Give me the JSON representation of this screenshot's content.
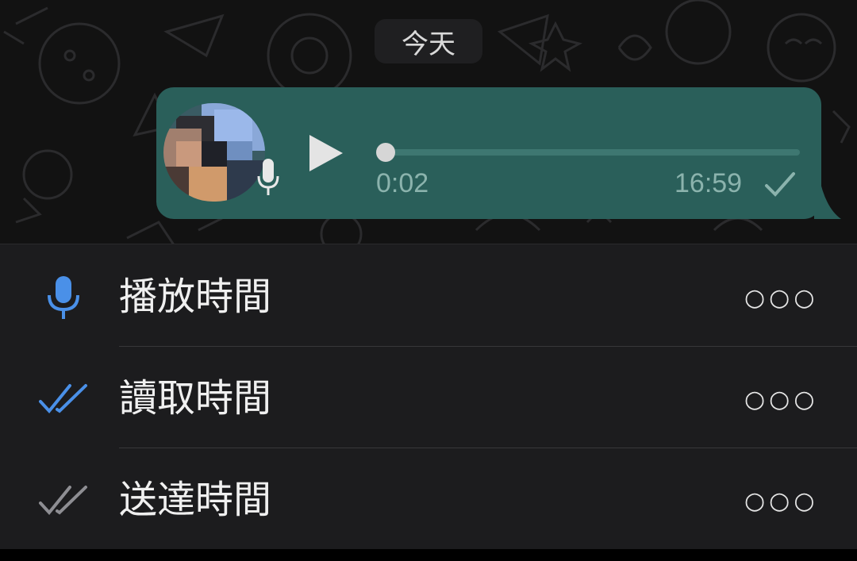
{
  "chat": {
    "date_label": "今天",
    "voice_message": {
      "duration": "0:02",
      "time": "16:59",
      "progress": 0
    }
  },
  "info": {
    "rows": [
      {
        "label": "播放時間",
        "value": "○○○",
        "icon": "microphone-icon",
        "icon_color": "#4a90e8"
      },
      {
        "label": "讀取時間",
        "value": "○○○",
        "icon": "double-check-blue-icon",
        "icon_color": "#4a90e8"
      },
      {
        "label": "送達時間",
        "value": "○○○",
        "icon": "double-check-gray-icon",
        "icon_color": "#8e8e93"
      }
    ]
  },
  "colors": {
    "bubble": "#2a5f5a",
    "panel": "#1c1c1e",
    "accent_blue": "#4a90e8"
  }
}
